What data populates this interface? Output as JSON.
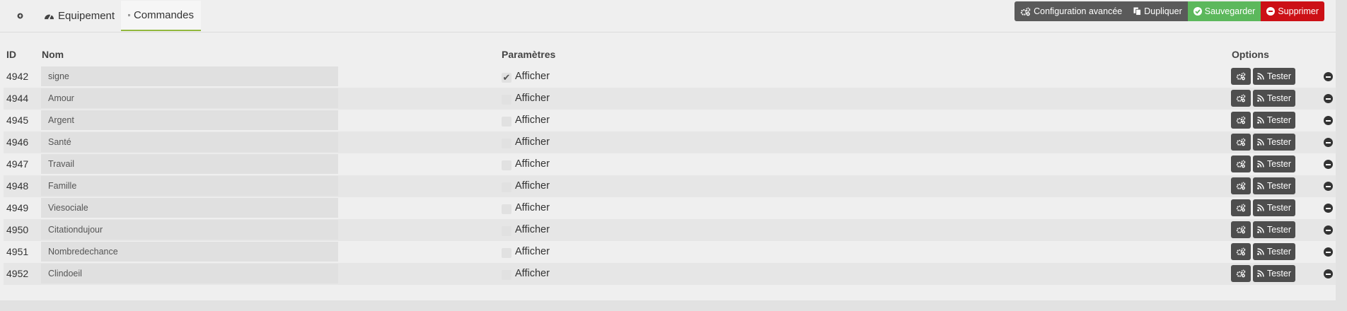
{
  "tabs": {
    "back_icon": "arrow-left-icon",
    "equipement": "Equipement",
    "commandes": "Commandes"
  },
  "actions": {
    "config": "Configuration avancée",
    "duplicate": "Dupliquer",
    "save": "Sauvegarder",
    "delete": "Supprimer"
  },
  "colors": {
    "accent_tab": "#92b83e",
    "save": "#5cb85c",
    "delete": "#cc1016",
    "buttons": "#4e4e4e"
  },
  "table": {
    "headers": {
      "id": "ID",
      "name": "Nom",
      "params": "Paramètres",
      "options": "Options"
    },
    "rows": [
      {
        "id": "4942",
        "name": "signe",
        "show": "Afficher",
        "checked": true,
        "test": "Tester"
      },
      {
        "id": "4944",
        "name": "Amour",
        "show": "Afficher",
        "checked": false,
        "test": "Tester"
      },
      {
        "id": "4945",
        "name": "Argent",
        "show": "Afficher",
        "checked": false,
        "test": "Tester"
      },
      {
        "id": "4946",
        "name": "Santé",
        "show": "Afficher",
        "checked": false,
        "test": "Tester"
      },
      {
        "id": "4947",
        "name": "Travail",
        "show": "Afficher",
        "checked": false,
        "test": "Tester"
      },
      {
        "id": "4948",
        "name": "Famille",
        "show": "Afficher",
        "checked": false,
        "test": "Tester"
      },
      {
        "id": "4949",
        "name": "Viesociale",
        "show": "Afficher",
        "checked": false,
        "test": "Tester"
      },
      {
        "id": "4950",
        "name": "Citationdujour",
        "show": "Afficher",
        "checked": false,
        "test": "Tester"
      },
      {
        "id": "4951",
        "name": "Nombredechance",
        "show": "Afficher",
        "checked": false,
        "test": "Tester"
      },
      {
        "id": "4952",
        "name": "Clindoeil",
        "show": "Afficher",
        "checked": false,
        "test": "Tester"
      }
    ]
  }
}
